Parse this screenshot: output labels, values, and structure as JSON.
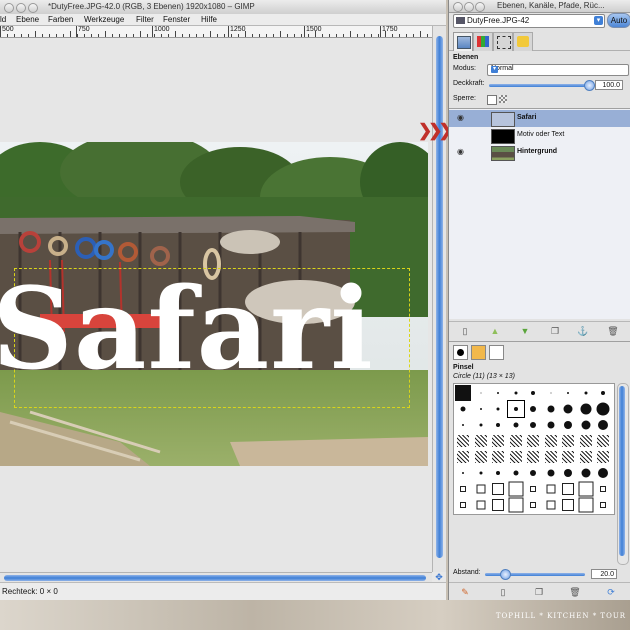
{
  "main_window": {
    "title": "*DutyFree.JPG-42.0 (RGB, 3 Ebenen) 1920x1080 – GIMP",
    "menu": [
      "ld",
      "Ebene",
      "Farben",
      "Werkzeuge",
      "Filter",
      "Fenster",
      "Hilfe"
    ],
    "ruler_labels": [
      "500",
      "750",
      "1000",
      "1250",
      "1500",
      "1750"
    ],
    "canvas_text": "Safari",
    "status": "Rechteck: 0 × 0"
  },
  "dock": {
    "title": "Ebenen, Kanäle, Pfade, Rüc...",
    "image_select": "DutyFree.JPG-42",
    "auto_label": "Auto",
    "layers": {
      "section_title": "Ebenen",
      "mode_label": "Modus:",
      "mode_value": "Normal",
      "opacity_label": "Deckkraft:",
      "opacity_value": "100.0",
      "opacity_fraction": 1.0,
      "lock_label": "Sperre:",
      "items": [
        {
          "name": "Safari",
          "visible": true,
          "selected": true,
          "bold": true
        },
        {
          "name": "Motiv oder Text",
          "visible": false,
          "selected": false,
          "bold": false
        },
        {
          "name": "Hintergrund",
          "visible": true,
          "selected": false,
          "bold": true
        }
      ]
    },
    "brushes": {
      "section_title": "Pinsel",
      "selected_brush": "Circle (11) (13 × 13)",
      "spacing_label": "Abstand:",
      "spacing_value": "20.0",
      "spacing_fraction": 0.2
    }
  },
  "watermark": "TOPHILL * KITCHEN * TOUR",
  "colors": {
    "scroll_accent": "#3f7fd6",
    "selected_row": "#98afd6",
    "arrows": "#c0302a",
    "selection_marquee": "#d9d51a",
    "fg_color": "#000000",
    "mid_color": "#f2b84b",
    "bg_color": "#ffffff"
  }
}
